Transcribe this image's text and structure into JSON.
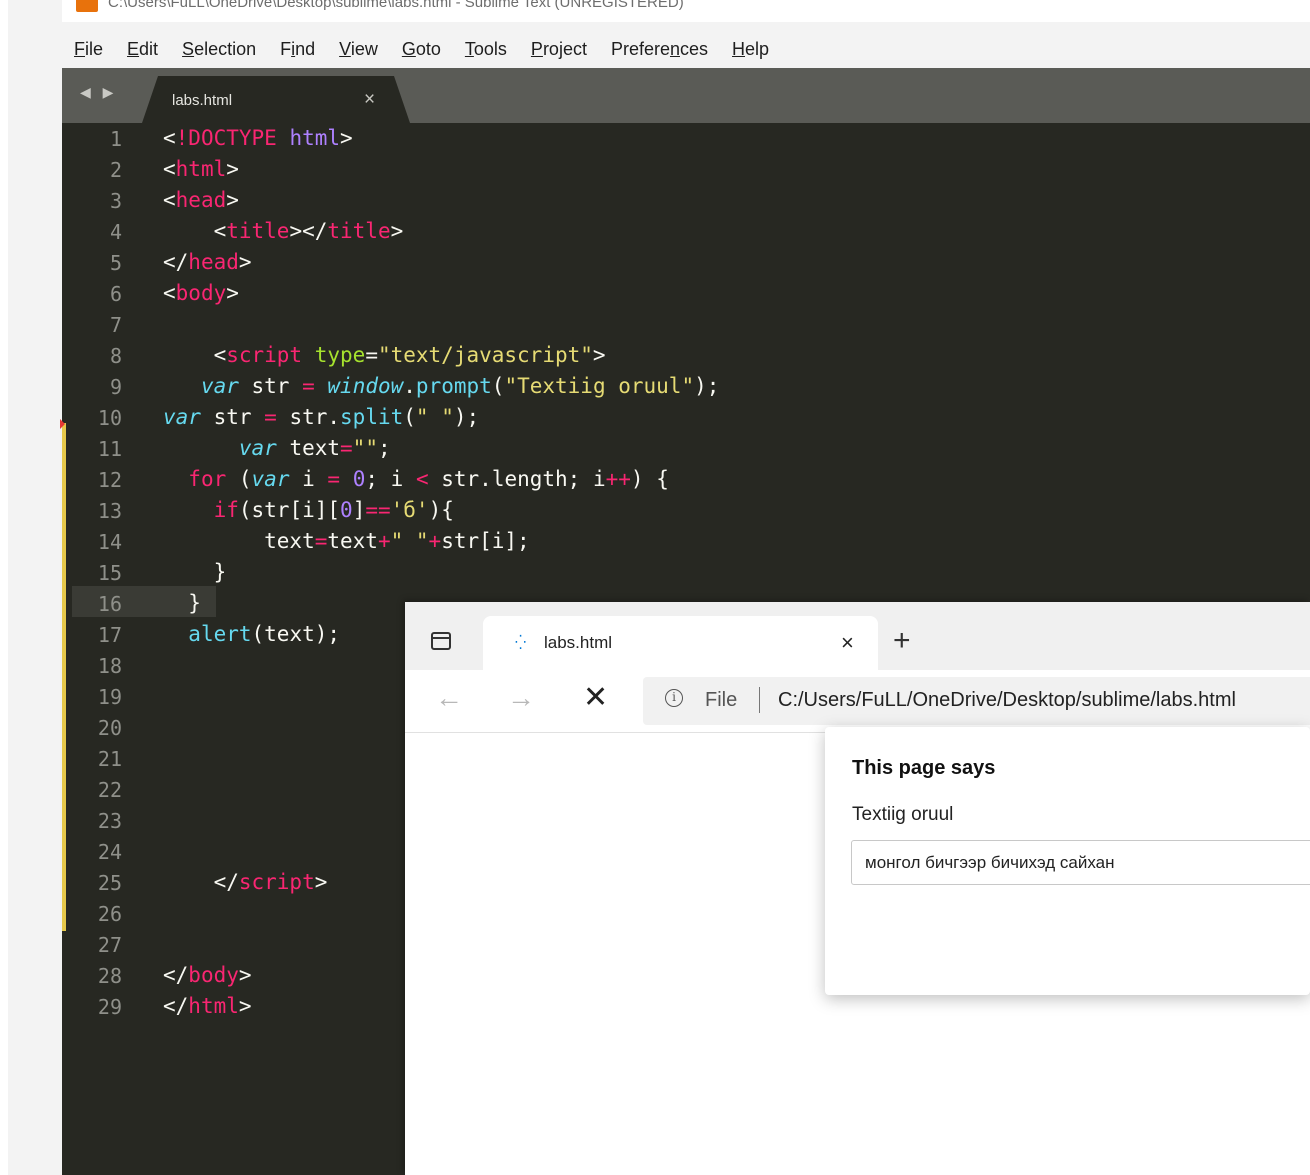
{
  "sublime": {
    "title_bar": "C:\\Users\\FuLL\\OneDrive\\Desktop\\sublime\\labs.html - Sublime Text (UNREGISTERED)",
    "menu": [
      {
        "pre": "",
        "u": "F",
        "post": "ile"
      },
      {
        "pre": "",
        "u": "E",
        "post": "dit"
      },
      {
        "pre": "",
        "u": "S",
        "post": "election"
      },
      {
        "pre": "F",
        "u": "i",
        "post": "nd"
      },
      {
        "pre": "",
        "u": "V",
        "post": "iew"
      },
      {
        "pre": "",
        "u": "G",
        "post": "oto"
      },
      {
        "pre": "",
        "u": "T",
        "post": "ools"
      },
      {
        "pre": "",
        "u": "P",
        "post": "roject"
      },
      {
        "pre": "Prefere",
        "u": "n",
        "post": "ces"
      },
      {
        "pre": "",
        "u": "H",
        "post": "elp"
      }
    ],
    "nav_arrows": "◀ ▶",
    "tab": {
      "label": "labs.html",
      "close": "×"
    },
    "line_numbers": [
      "1",
      "2",
      "3",
      "4",
      "5",
      "6",
      "7",
      "8",
      "9",
      "10",
      "11",
      "12",
      "13",
      "14",
      "15",
      "16",
      "17",
      "18",
      "19",
      "20",
      "21",
      "22",
      "23",
      "24",
      "25",
      "26",
      "27",
      "28",
      "29"
    ],
    "code_lines": [
      [
        {
          "t": "<",
          "c": "wh"
        },
        {
          "t": "!DOCTYPE",
          "c": "tg"
        },
        {
          "t": " ",
          "c": "wh"
        },
        {
          "t": "html",
          "c": "sv"
        },
        {
          "t": ">",
          "c": "wh"
        }
      ],
      [
        {
          "t": "<",
          "c": "wh"
        },
        {
          "t": "html",
          "c": "tg"
        },
        {
          "t": ">",
          "c": "wh"
        }
      ],
      [
        {
          "t": "<",
          "c": "wh"
        },
        {
          "t": "head",
          "c": "tg"
        },
        {
          "t": ">",
          "c": "wh"
        }
      ],
      [
        {
          "t": "    <",
          "c": "wh"
        },
        {
          "t": "title",
          "c": "tg"
        },
        {
          "t": "></",
          "c": "wh"
        },
        {
          "t": "title",
          "c": "tg"
        },
        {
          "t": ">",
          "c": "wh"
        }
      ],
      [
        {
          "t": "</",
          "c": "wh"
        },
        {
          "t": "head",
          "c": "tg"
        },
        {
          "t": ">",
          "c": "wh"
        }
      ],
      [
        {
          "t": "<",
          "c": "wh"
        },
        {
          "t": "body",
          "c": "tg"
        },
        {
          "t": ">",
          "c": "wh"
        }
      ],
      [],
      [
        {
          "t": "    <",
          "c": "wh"
        },
        {
          "t": "script",
          "c": "tg"
        },
        {
          "t": " ",
          "c": "wh"
        },
        {
          "t": "type",
          "c": "at"
        },
        {
          "t": "=",
          "c": "wh"
        },
        {
          "t": "\"text/javascript\"",
          "c": "st"
        },
        {
          "t": ">",
          "c": "wh"
        }
      ],
      [
        {
          "t": "   ",
          "c": "wh"
        },
        {
          "t": "var",
          "c": "it"
        },
        {
          "t": " str ",
          "c": "wh"
        },
        {
          "t": "=",
          "c": "kw"
        },
        {
          "t": " ",
          "c": "wh"
        },
        {
          "t": "window",
          "c": "it"
        },
        {
          "t": ".",
          "c": "wh"
        },
        {
          "t": "prompt",
          "c": "fn"
        },
        {
          "t": "(",
          "c": "wh"
        },
        {
          "t": "\"Textiig oruul\"",
          "c": "st"
        },
        {
          "t": ");",
          "c": "wh"
        }
      ],
      [
        {
          "t": "var",
          "c": "it"
        },
        {
          "t": " str ",
          "c": "wh"
        },
        {
          "t": "=",
          "c": "kw"
        },
        {
          "t": " str.",
          "c": "wh"
        },
        {
          "t": "split",
          "c": "fn"
        },
        {
          "t": "(",
          "c": "wh"
        },
        {
          "t": "\" \"",
          "c": "st"
        },
        {
          "t": ");",
          "c": "wh"
        }
      ],
      [
        {
          "t": "      ",
          "c": "wh"
        },
        {
          "t": "var",
          "c": "it"
        },
        {
          "t": " text",
          "c": "wh"
        },
        {
          "t": "=",
          "c": "kw"
        },
        {
          "t": "\"\"",
          "c": "st"
        },
        {
          "t": ";",
          "c": "wh"
        }
      ],
      [
        {
          "t": "  ",
          "c": "wh"
        },
        {
          "t": "for",
          "c": "kw"
        },
        {
          "t": " (",
          "c": "wh"
        },
        {
          "t": "var",
          "c": "it"
        },
        {
          "t": " i ",
          "c": "wh"
        },
        {
          "t": "=",
          "c": "kw"
        },
        {
          "t": " ",
          "c": "wh"
        },
        {
          "t": "0",
          "c": "sv"
        },
        {
          "t": "; i ",
          "c": "wh"
        },
        {
          "t": "<",
          "c": "kw"
        },
        {
          "t": " str.length; i",
          "c": "wh"
        },
        {
          "t": "++",
          "c": "kw"
        },
        {
          "t": ") {",
          "c": "wh"
        }
      ],
      [
        {
          "t": "    ",
          "c": "wh"
        },
        {
          "t": "if",
          "c": "kw"
        },
        {
          "t": "(str[i][",
          "c": "wh"
        },
        {
          "t": "0",
          "c": "sv"
        },
        {
          "t": "]",
          "c": "wh"
        },
        {
          "t": "==",
          "c": "kw"
        },
        {
          "t": "'б'",
          "c": "st"
        },
        {
          "t": "){",
          "c": "wh"
        }
      ],
      [
        {
          "t": "        text",
          "c": "wh"
        },
        {
          "t": "=",
          "c": "kw"
        },
        {
          "t": "text",
          "c": "wh"
        },
        {
          "t": "+",
          "c": "kw"
        },
        {
          "t": "\" \"",
          "c": "st"
        },
        {
          "t": "+",
          "c": "kw"
        },
        {
          "t": "str[i];",
          "c": "wh"
        }
      ],
      [
        {
          "t": "    }",
          "c": "wh"
        }
      ],
      [
        {
          "t": "  }",
          "c": "wh"
        }
      ],
      [
        {
          "t": "  ",
          "c": "wh"
        },
        {
          "t": "alert",
          "c": "fn"
        },
        {
          "t": "(text);",
          "c": "wh"
        }
      ],
      [],
      [],
      [],
      [],
      [],
      [],
      [],
      [
        {
          "t": "    </",
          "c": "wh"
        },
        {
          "t": "script",
          "c": "tg"
        },
        {
          "t": ">",
          "c": "wh"
        }
      ],
      [],
      [],
      [
        {
          "t": "</",
          "c": "wh"
        },
        {
          "t": "body",
          "c": "tg"
        },
        {
          "t": ">",
          "c": "wh"
        }
      ],
      [
        {
          "t": "</",
          "c": "wh"
        },
        {
          "t": "html",
          "c": "tg"
        },
        {
          "t": ">",
          "c": "wh"
        }
      ]
    ]
  },
  "browser": {
    "tab_label": "labs.html",
    "tab_close": "×",
    "new_tab": "+",
    "back": "←",
    "forward": "→",
    "stop": "✕",
    "info": "i",
    "scheme_label": "File",
    "url": "C:/Users/FuLL/OneDrive/Desktop/sublime/labs.html"
  },
  "dialog": {
    "title": "This page says",
    "message": "Textiig oruul",
    "input_value": "монгол бичгээр бичихэд сайхан"
  }
}
